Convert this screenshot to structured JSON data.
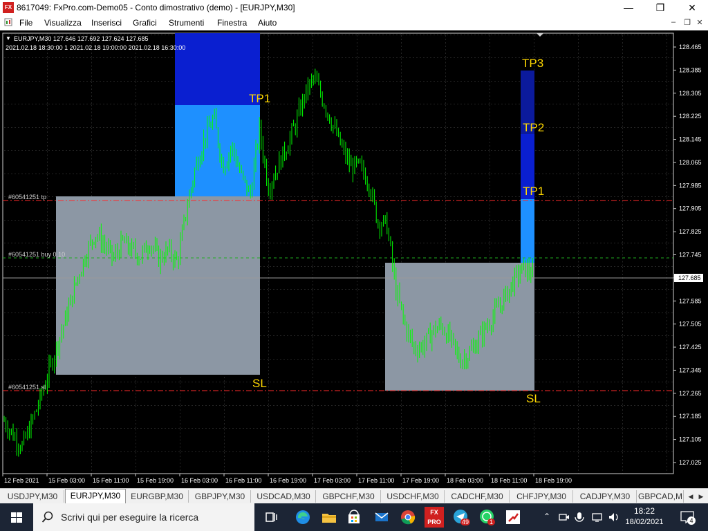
{
  "window": {
    "title": "8617049: FxPro.com-Demo05 - Conto dimostrativo (demo) - [EURJPY,M30]",
    "logo_text": "FX"
  },
  "menu": {
    "items": [
      "File",
      "Visualizza",
      "Inserisci",
      "Grafici",
      "Strumenti",
      "Finestra",
      "Aiuto"
    ]
  },
  "chart": {
    "header_line1": "EURJPY,M30  127.646 127.692 127.624 127.685",
    "header_line2": "2021.02.18 18:30:00 1 2021.02.18 19:00:00 2021.02.18 16:30:00",
    "current_price": "127.685",
    "order_tp_label": "#60541251 tp",
    "order_buy_label": "#60541251 buy 0.10",
    "order_sl_label": "#60541251 sl",
    "zone_labels": [
      "TP1",
      "SL",
      "TP3",
      "TP2",
      "TP1",
      "SL"
    ],
    "colors": {
      "background": "#000000",
      "candle": "#00ff00",
      "zone_grey": "#8c97a4",
      "zone_light_blue": "#1e90ff",
      "zone_dark_blue": "#0a1fd0",
      "zone_navy": "#0b1a9c",
      "level_red": "#ff2a2a",
      "level_green": "#1fae1f",
      "label_yellow": "#ffd800"
    }
  },
  "chart_data": {
    "type": "candlestick",
    "symbol": "EURJPY",
    "timeframe": "M30",
    "ylim": [
      127.025,
      128.465
    ],
    "y_ticks": [
      "128.465",
      "128.385",
      "128.305",
      "128.225",
      "128.145",
      "128.065",
      "127.985",
      "127.905",
      "127.825",
      "127.745",
      "127.665",
      "127.585",
      "127.505",
      "127.425",
      "127.345",
      "127.265",
      "127.185",
      "127.105",
      "127.025"
    ],
    "x_ticks": [
      "12 Feb 2021",
      "15 Feb 03:00",
      "15 Feb 11:00",
      "15 Feb 19:00",
      "16 Feb 03:00",
      "16 Feb 11:00",
      "16 Feb 19:00",
      "17 Feb 03:00",
      "17 Feb 11:00",
      "17 Feb 19:00",
      "18 Feb 03:00",
      "18 Feb 11:00",
      "18 Feb 19:00"
    ],
    "close_path": [
      127.17,
      127.12,
      127.08,
      127.16,
      127.25,
      127.35,
      127.45,
      127.55,
      127.66,
      127.75,
      127.82,
      127.78,
      127.73,
      127.79,
      127.76,
      127.74,
      127.79,
      127.73,
      127.76,
      127.72,
      127.9,
      128.05,
      128.15,
      128.22,
      128.05,
      128.12,
      128.02,
      127.95,
      128.18,
      127.98,
      128.05,
      128.12,
      128.2,
      128.3,
      128.36,
      128.28,
      128.2,
      128.12,
      128.05,
      128.05,
      128.0,
      127.86,
      127.85,
      127.62,
      127.5,
      127.42,
      127.43,
      127.48,
      127.5,
      127.45,
      127.38,
      127.4,
      127.45,
      127.5,
      127.55,
      127.6,
      127.66,
      127.7,
      127.68
    ],
    "last_price": 127.685,
    "order_levels": {
      "tp": 127.96,
      "buy": 127.76,
      "sl": 127.305
    }
  },
  "tabs": [
    "USDJPY,M30",
    "EURJPY,M30",
    "EURGBP,M30",
    "GBPJPY,M30",
    "USDCAD,M30",
    "GBPCHF,M30",
    "USDCHF,M30",
    "CADCHF,M30",
    "CHFJPY,M30",
    "CADJPY,M30",
    "GBPCAD,M"
  ],
  "active_tab": "EURJPY,M30",
  "taskbar": {
    "search_placeholder": "Scrivi qui per eseguire la ricerca",
    "time": "18:22",
    "date": "18/02/2021",
    "notification_count": "4",
    "badge_49": "49",
    "badge_1": "1",
    "fxpro_text": "FX PRO"
  }
}
